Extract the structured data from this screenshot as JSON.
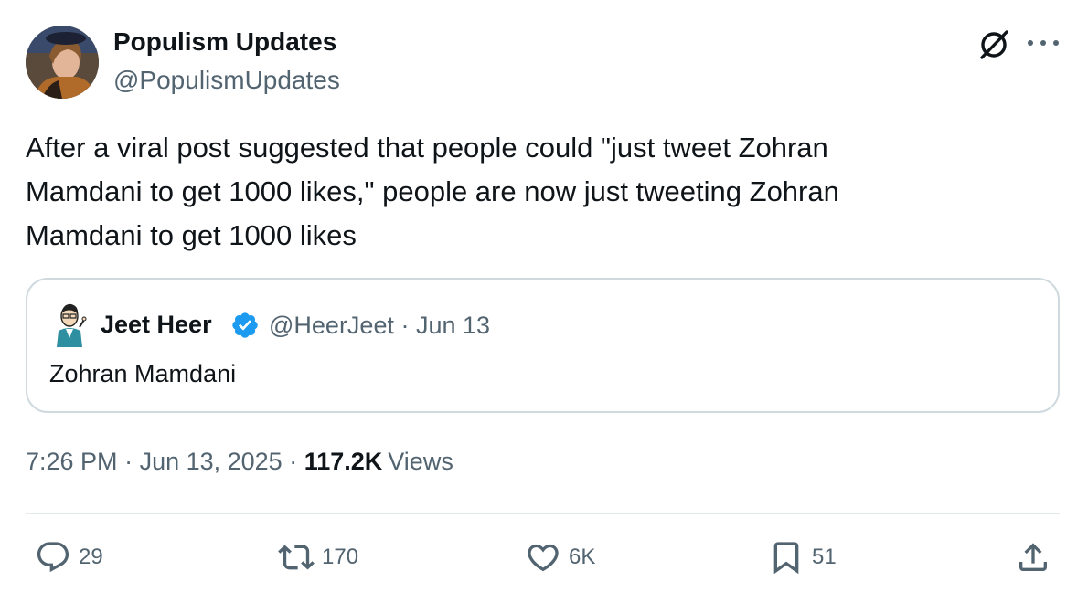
{
  "author": {
    "name": "Populism Updates",
    "handle": "@PopulismUpdates"
  },
  "tweet": {
    "text_line1": "After a viral post suggested that people could \"just tweet Zohran",
    "text_line2": "Mamdani to get 1000 likes,\" people are now just tweeting Zohran",
    "text_line3": "Mamdani to get 1000 likes"
  },
  "quote": {
    "name": "Jeet Heer",
    "handle_date": "@HeerJeet · Jun 13",
    "text": "Zohran Mamdani"
  },
  "meta": {
    "time": "7:26 PM",
    "sep1": " · ",
    "date": "Jun 13, 2025",
    "sep2": " · ",
    "views_count": "117.2K",
    "views_label": "Views"
  },
  "actions": {
    "replies": "29",
    "reposts": "170",
    "likes": "6K",
    "bookmarks": "51"
  },
  "icons": {
    "header": [
      "grok-icon",
      "more-icon"
    ],
    "actions": [
      "reply-icon",
      "repost-icon",
      "like-icon",
      "bookmark-icon",
      "share-icon"
    ],
    "badge": "verified-icon"
  },
  "colors": {
    "text_primary": "#0f1419",
    "text_secondary": "#536471",
    "border": "#cfd9de",
    "verified": "#1d9bf0"
  }
}
